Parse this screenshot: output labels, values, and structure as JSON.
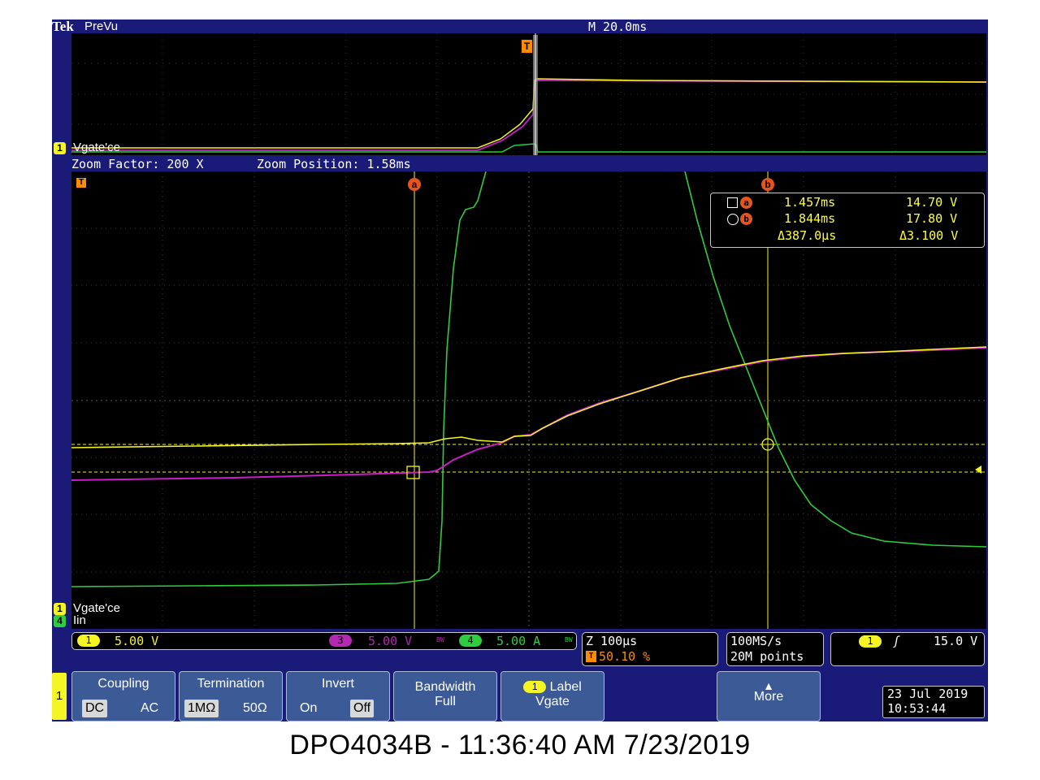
{
  "header": {
    "logo": "Tek",
    "mode": "PreVu",
    "timebase": "M 20.0ms"
  },
  "overview": {
    "channel_label": "Vgate'ce",
    "channel_number": "1",
    "trigger_marker": "T"
  },
  "zoom": {
    "factor": "Zoom Factor: 200 X",
    "position": "Zoom Position: 1.58ms"
  },
  "graticule": {
    "trigger_marker": "T",
    "cursor_a_label": "a",
    "cursor_b_label": "b",
    "channel_labels": [
      {
        "number": "1",
        "name": "Vgate'ce",
        "color": "#f5f523"
      },
      {
        "number": "4",
        "name": "Iin",
        "color": "#2ecc40"
      }
    ]
  },
  "cursor_readout": {
    "rows": [
      {
        "cursor": "a",
        "time": "1.457ms",
        "value": "14.70 V"
      },
      {
        "cursor": "b",
        "time": "1.844ms",
        "value": "17.80 V"
      },
      {
        "cursor": "delta",
        "time": "Δ387.0µs",
        "value": "Δ3.100 V"
      }
    ]
  },
  "status": {
    "ch1": {
      "number": "1",
      "scale": "5.00 V",
      "color": "#f5f523"
    },
    "ch3": {
      "number": "3",
      "scale": "5.00 V",
      "color": "#b428b4"
    },
    "ch4": {
      "number": "4",
      "scale": "5.00 A",
      "color": "#2ecc40"
    },
    "bw_mark": "BW",
    "zoom_scale": "Z 100µs",
    "trigger_pos": "50.10 %",
    "sample_rate": "100MS/s",
    "record_length": "20M points",
    "trigger_channel": "1",
    "trigger_level": "15.0 V"
  },
  "menu": {
    "channel": "1",
    "coupling": {
      "title": "Coupling",
      "options": [
        "DC",
        "AC"
      ],
      "selected": "DC"
    },
    "termination": {
      "title": "Termination",
      "options": [
        "1MΩ",
        "50Ω"
      ],
      "selected": "1MΩ"
    },
    "invert": {
      "title": "Invert",
      "options": [
        "On",
        "Off"
      ],
      "selected": "Off"
    },
    "bandwidth": {
      "title": "Bandwidth",
      "value": "Full"
    },
    "label": {
      "channel": "1",
      "title": "Label",
      "value": "Vgate"
    },
    "more": {
      "title": "More"
    },
    "date": "23 Jul  2019",
    "time": "10:53:44"
  },
  "caption": "DPO4034B - 11:36:40 AM   7/23/2019",
  "colors": {
    "ch1": "#f5f523",
    "ch3": "#c81ec8",
    "ch4": "#2ecc40",
    "cursor": "#f5f523",
    "frame": "#1a1a78",
    "menu": "#3c5a96"
  }
}
